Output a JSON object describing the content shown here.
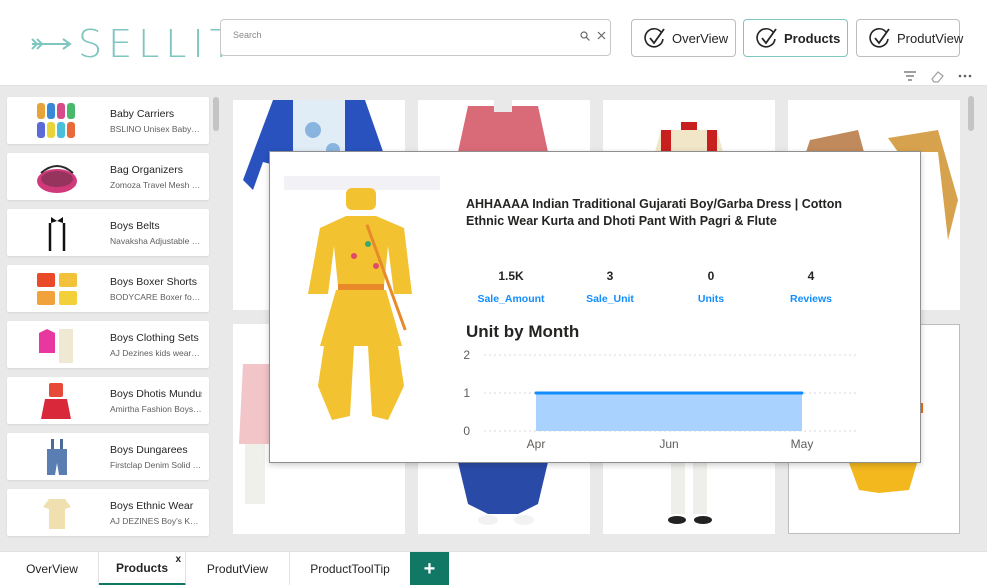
{
  "app": {
    "logo_text": "SELLIT"
  },
  "search": {
    "placeholder": "Search",
    "value": ""
  },
  "nav": [
    {
      "label": "OverView"
    },
    {
      "label": "Products"
    },
    {
      "label": "ProdutView"
    }
  ],
  "categories": [
    {
      "title": "Baby Carriers",
      "subtitle": "BSLINO Unisex Baby Socks"
    },
    {
      "title": "Bag Organizers",
      "subtitle": "Zomoza Travel Mesh Organizer"
    },
    {
      "title": "Boys Belts",
      "subtitle": "Navaksha Adjustable Suspenders"
    },
    {
      "title": "Boys Boxer Shorts",
      "subtitle": "BODYCARE Boxer for Boys"
    },
    {
      "title": "Boys Clothing Sets",
      "subtitle": "AJ Dezines kids wear set"
    },
    {
      "title": "Boys Dhotis Mundus",
      "subtitle": "Amirtha Fashion Boys Dhoti"
    },
    {
      "title": "Boys Dungarees",
      "subtitle": "Firstclap Denim Solid Dungaree"
    },
    {
      "title": "Boys Ethnic Wear",
      "subtitle": "AJ DEZINES Boy's Kurta"
    }
  ],
  "tooltip": {
    "title": "AHHAAAA Indian Traditional Gujarati Boy/Garba Dress | Cotton Ethnic Wear Kurta and Dhoti Pant With Pagri & Flute",
    "kpis": [
      {
        "value": "1.5K",
        "label": "Sale_Amount"
      },
      {
        "value": "3",
        "label": "Sale_Unit"
      },
      {
        "value": "0",
        "label": "Units"
      },
      {
        "value": "4",
        "label": "Reviews"
      }
    ],
    "chart_title": "Unit by Month"
  },
  "chart_data": {
    "type": "area",
    "title": "Unit by Month",
    "x": [
      "Apr",
      "Jun",
      "May"
    ],
    "values": [
      1,
      1,
      1
    ],
    "ylim": [
      0,
      2
    ],
    "yticks": [
      "0",
      "1",
      "2"
    ],
    "grid": true,
    "color": "#118dff",
    "fill": "#a9d2ff"
  },
  "tabs": [
    {
      "label": "OverView"
    },
    {
      "label": "Products",
      "close": "x"
    },
    {
      "label": "ProdutView"
    },
    {
      "label": "ProductToolTip"
    }
  ],
  "tab_add": "+",
  "colors": {
    "accent": "#117865",
    "kpi": "#118dff",
    "logo": "#7fc5c0"
  }
}
